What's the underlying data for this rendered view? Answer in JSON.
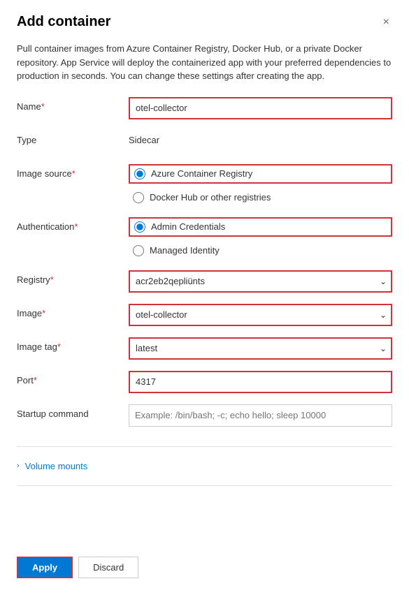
{
  "dialog": {
    "title": "Add container",
    "close_label": "×",
    "description": "Pull container images from Azure Container Registry, Docker Hub, or a private Docker repository. App Service will deploy the containerized app with your preferred dependencies to production in seconds. You can change these settings after creating the app."
  },
  "form": {
    "name_label": "Name",
    "name_required": "*",
    "name_value": "otel-collector",
    "type_label": "Type",
    "type_value": "Sidecar",
    "image_source_label": "Image source",
    "image_source_required": "*",
    "image_source_option1": "Azure Container Registry",
    "image_source_option2": "Docker Hub or other registries",
    "authentication_label": "Authentication",
    "authentication_required": "*",
    "auth_option1": "Admin Credentials",
    "auth_option2": "Managed Identity",
    "registry_label": "Registry",
    "registry_required": "*",
    "registry_value": "acr2eb2qepliünts",
    "image_label": "Image",
    "image_required": "*",
    "image_value": "otel-collector",
    "image_tag_label": "Image tag",
    "image_tag_required": "*",
    "image_tag_value": "latest",
    "port_label": "Port",
    "port_required": "*",
    "port_value": "4317",
    "startup_command_label": "Startup command",
    "startup_command_placeholder": "Example: /bin/bash; -c; echo hello; sleep 10000"
  },
  "volume_mounts": {
    "label": "Volume mounts"
  },
  "footer": {
    "apply_label": "Apply",
    "discard_label": "Discard"
  },
  "icons": {
    "close": "✕",
    "chevron_down": "∨",
    "chevron_right": "›"
  }
}
